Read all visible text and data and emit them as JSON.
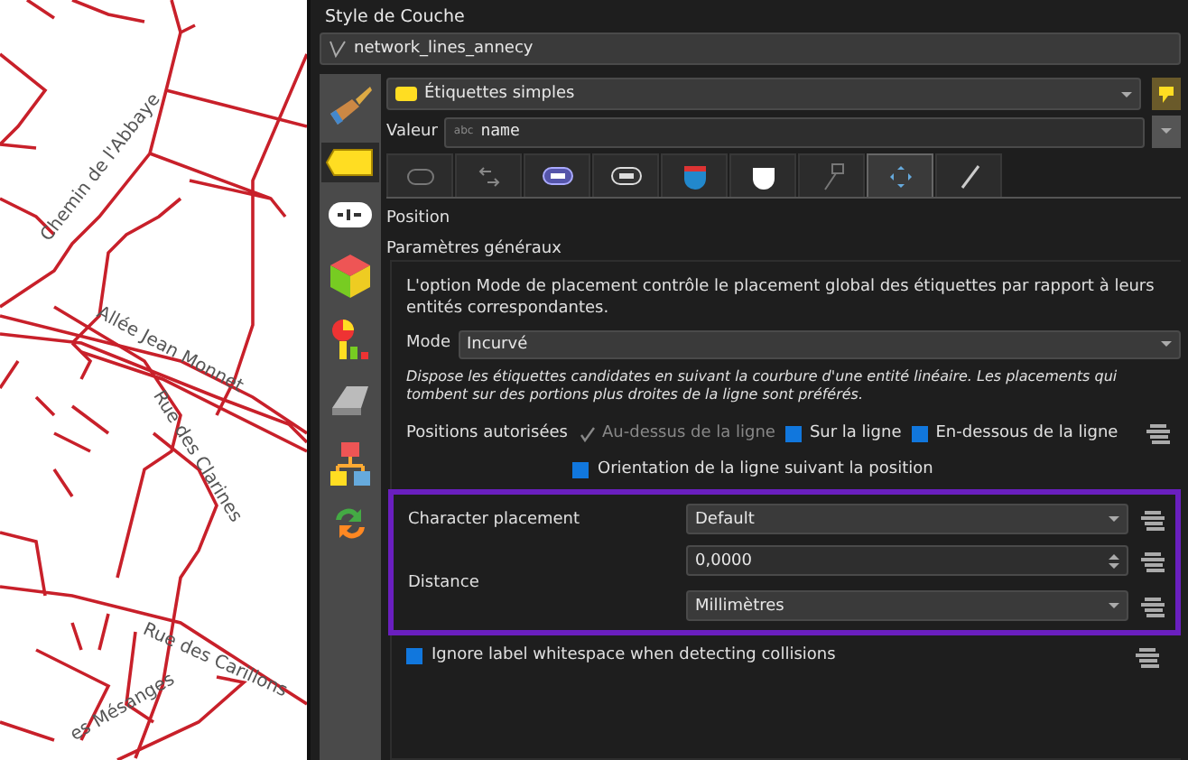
{
  "map": {
    "street_labels": [
      {
        "text": "Chemin de l'Abbaye"
      },
      {
        "text": "Allée Jean Monnet"
      },
      {
        "text": "Rue des Clarines"
      },
      {
        "text": "Rue des Carillons"
      },
      {
        "text": "es Mésanges"
      }
    ]
  },
  "panel": {
    "title": "Style de Couche",
    "layer": "network_lines_annecy",
    "side_tabs": [
      {
        "kind": "brush",
        "selected": false
      },
      {
        "kind": "label",
        "selected": true
      },
      {
        "kind": "text",
        "selected": false
      },
      {
        "kind": "cube",
        "selected": false
      },
      {
        "kind": "diagram",
        "selected": false
      },
      {
        "kind": "terrain",
        "selected": false
      },
      {
        "kind": "hierarchy",
        "selected": false
      },
      {
        "kind": "arrows",
        "selected": false
      }
    ],
    "renderer": "Étiquettes simples",
    "value_label": "Valeur",
    "value_type": "abc",
    "value": "name",
    "sub_tabs": [
      {
        "kind": "text",
        "selected": false
      },
      {
        "kind": "format",
        "selected": false
      },
      {
        "kind": "buffer",
        "selected": false
      },
      {
        "kind": "mask",
        "selected": false
      },
      {
        "kind": "background",
        "selected": false
      },
      {
        "kind": "shadow",
        "selected": false
      },
      {
        "kind": "callout",
        "selected": false
      },
      {
        "kind": "placement",
        "selected": true
      },
      {
        "kind": "render",
        "selected": false
      }
    ],
    "section": "Position",
    "group_title": "Paramètres généraux",
    "description": "L'option Mode de placement contrôle le placement global des étiquettes par rapport à leurs entités correspondantes.",
    "mode_label": "Mode",
    "mode": "Incurvé",
    "mode_hint": "Dispose les étiquettes candidates en suivant la courbure d'une entité linéaire. Les placements qui tombent sur des portions plus droites de la ligne sont préférés.",
    "positions_label": "Positions autorisées",
    "positions": [
      {
        "label": "Au-dessus de la ligne",
        "checked": true,
        "disabled": true
      },
      {
        "label": "Sur la ligne",
        "checked": true,
        "disabled": false
      },
      {
        "label": "En-dessous de la ligne",
        "checked": true,
        "disabled": false
      }
    ],
    "orientation": {
      "label": "Orientation de la ligne suivant la position",
      "checked": true
    },
    "highlighted": true,
    "char_placement_label": "Character placement",
    "char_placement": "Default",
    "distance_label": "Distance",
    "distance": "0,0000",
    "distance_unit": "Millimètres",
    "ignore_whitespace": {
      "label": "Ignore label whitespace when detecting collisions",
      "checked": true
    }
  }
}
